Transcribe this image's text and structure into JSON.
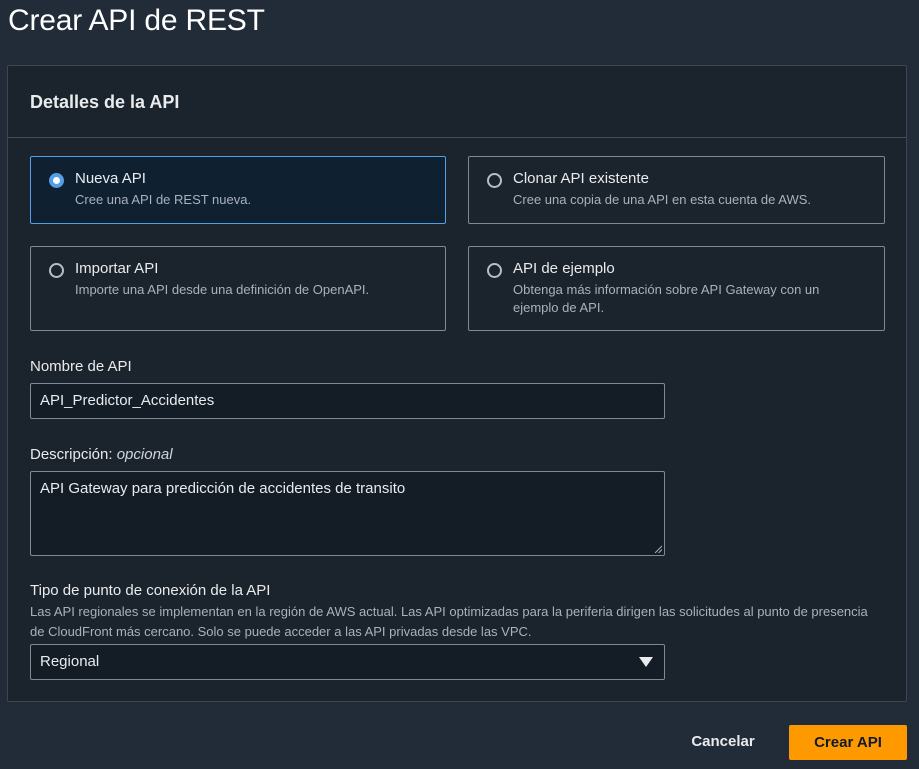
{
  "page": {
    "title": "Crear API de REST"
  },
  "panel": {
    "header": "Detalles de la API"
  },
  "api_options": [
    {
      "title": "Nueva API",
      "description": "Cree una API de REST nueva.",
      "selected": true
    },
    {
      "title": "Clonar API existente",
      "description": "Cree una copia de una API en esta cuenta de AWS.",
      "selected": false
    },
    {
      "title": "Importar API",
      "description": "Importe una API desde una definición de OpenAPI.",
      "selected": false
    },
    {
      "title": "API de ejemplo",
      "description": "Obtenga más información sobre API Gateway con un ejemplo de API.",
      "selected": false
    }
  ],
  "api_name": {
    "label": "Nombre de API",
    "value": "API_Predictor_Accidentes"
  },
  "description": {
    "label": "Descripción:",
    "optional": "opcional",
    "value": "API Gateway para predicción de accidentes de transito"
  },
  "endpoint_type": {
    "label": "Tipo de punto de conexión de la API",
    "help": "Las API regionales se implementan en la región de AWS actual. Las API optimizadas para la periferia dirigen las solicitudes al punto de presencia de CloudFront más cercano. Solo se puede acceder a las API privadas desde las VPC.",
    "selected": "Regional"
  },
  "actions": {
    "cancel": "Cancelar",
    "submit": "Crear API"
  },
  "colors": {
    "accent": "#ff9900",
    "selection": "#539fe5"
  }
}
